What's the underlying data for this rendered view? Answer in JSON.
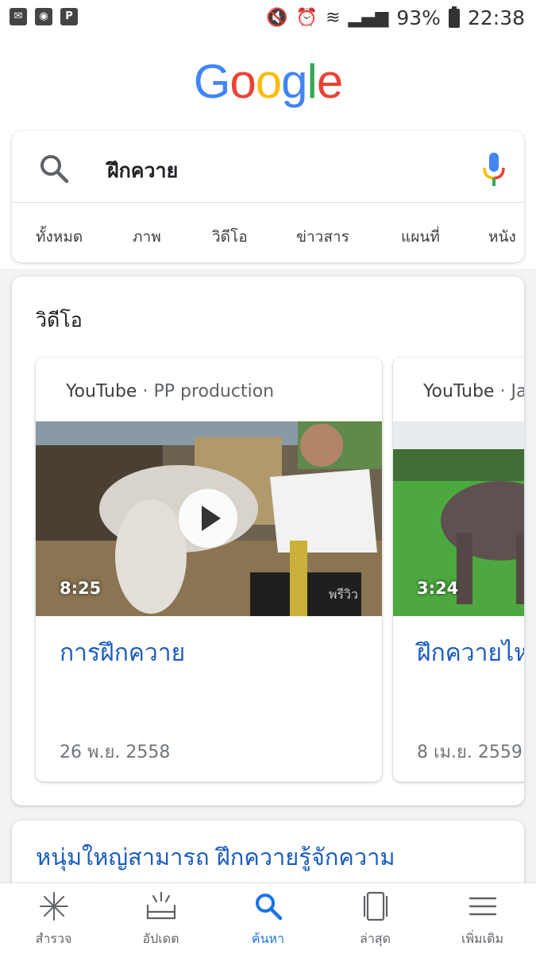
{
  "status_bar": {
    "battery": "93%",
    "time": "22:38"
  },
  "logo": {
    "letters": [
      "G",
      "o",
      "o",
      "g",
      "l",
      "e"
    ],
    "colors": [
      "#4285f4",
      "#ea4335",
      "#fbbc05",
      "#4285f4",
      "#34a853",
      "#ea4335"
    ]
  },
  "search": {
    "query": "ฝึกควาย",
    "tabs": [
      "ทั้งหมด",
      "ภาพ",
      "วิดีโอ",
      "ข่าวสาร",
      "แผนที่",
      "หนัง"
    ]
  },
  "videos": {
    "heading": "วิดีโอ",
    "cards": [
      {
        "source": "YouTube",
        "separator": " · ",
        "channel": "PP production",
        "duration": "8:25",
        "watermark": "พรีวิว",
        "title": "การฝึกควาย",
        "date": "26 พ.ย. 2558"
      },
      {
        "source": "YouTube",
        "separator": " · ",
        "channel": "Ja",
        "duration": "3:24",
        "title": "ฝึกควายไห",
        "date": "8 เม.ย. 2559"
      }
    ]
  },
  "result": {
    "title": "หนุ่มใหญ่สามารถ ฝึกควายรู้จักความ"
  },
  "bottom_nav": {
    "items": [
      {
        "label": "สำรวจ",
        "icon": "sparkle-icon"
      },
      {
        "label": "อัปเดต",
        "icon": "updates-icon"
      },
      {
        "label": "ค้นหา",
        "icon": "search-icon"
      },
      {
        "label": "ล่าสุด",
        "icon": "recent-icon"
      },
      {
        "label": "เพิ่มเติม",
        "icon": "menu-icon"
      }
    ],
    "active_index": 2
  },
  "colors": {
    "accent": "#1a73e8",
    "link": "#1a5cbf"
  }
}
